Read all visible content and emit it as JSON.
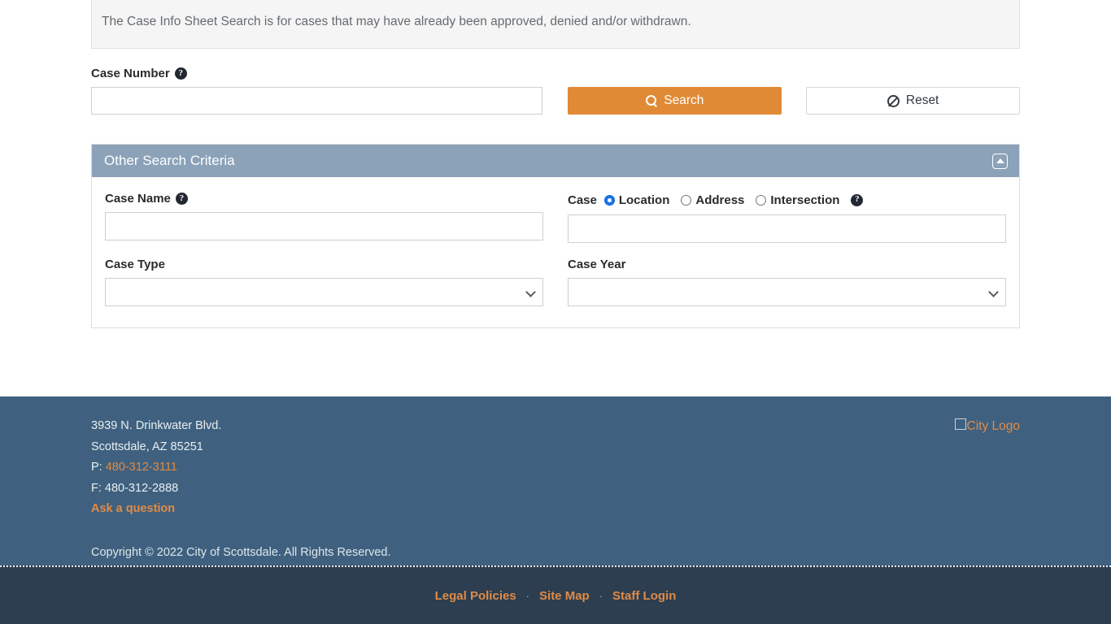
{
  "info_box": {
    "text": "The Case Info Sheet Search is for cases that may have already been approved, denied and/or withdrawn."
  },
  "case_number": {
    "label": "Case Number",
    "help_icon": "help-circle-icon",
    "value": "",
    "placeholder": ""
  },
  "buttons": {
    "search_label": "Search",
    "search_icon": "search-icon",
    "reset_label": "Reset",
    "reset_icon": "ban-icon"
  },
  "panel": {
    "title": "Other Search Criteria",
    "collapse_icon": "caret-up-icon",
    "case_name": {
      "label": "Case Name",
      "help_icon": "help-circle-icon",
      "value": "",
      "placeholder": ""
    },
    "case_location": {
      "label": "Case",
      "help_icon": "help-circle-icon",
      "options": [
        {
          "label": "Location",
          "selected": true
        },
        {
          "label": "Address",
          "selected": false
        },
        {
          "label": "Intersection",
          "selected": false
        }
      ],
      "value": "",
      "placeholder": ""
    },
    "case_type": {
      "label": "Case Type",
      "selected": "",
      "options": [
        ""
      ]
    },
    "case_year": {
      "label": "Case Year",
      "selected": "",
      "options": [
        ""
      ]
    }
  },
  "footer": {
    "address_line1": "3939 N. Drinkwater Blvd.",
    "address_line2": "Scottsdale, AZ 85251",
    "phone_prefix": "P: ",
    "phone": "480-312-3111",
    "fax": "F: 480-312-2888",
    "ask_link": "Ask a question",
    "logo_alt": "City Logo",
    "logo_icon": "broken-image-icon",
    "copyright": "Copyright © 2022 City of Scottsdale. All Rights Reserved."
  },
  "footer_bottom": {
    "links": [
      "Legal Policies",
      "Site Map",
      "Staff Login"
    ],
    "separator": "·"
  },
  "colors": {
    "accent_orange": "#e18a36",
    "panel_header": "#8ba2b8",
    "footer_bg": "#3f617f",
    "footer_bottom_bg": "#2c3e50",
    "link_orange": "#e08b48",
    "radio_selected": "#1a73e8"
  }
}
